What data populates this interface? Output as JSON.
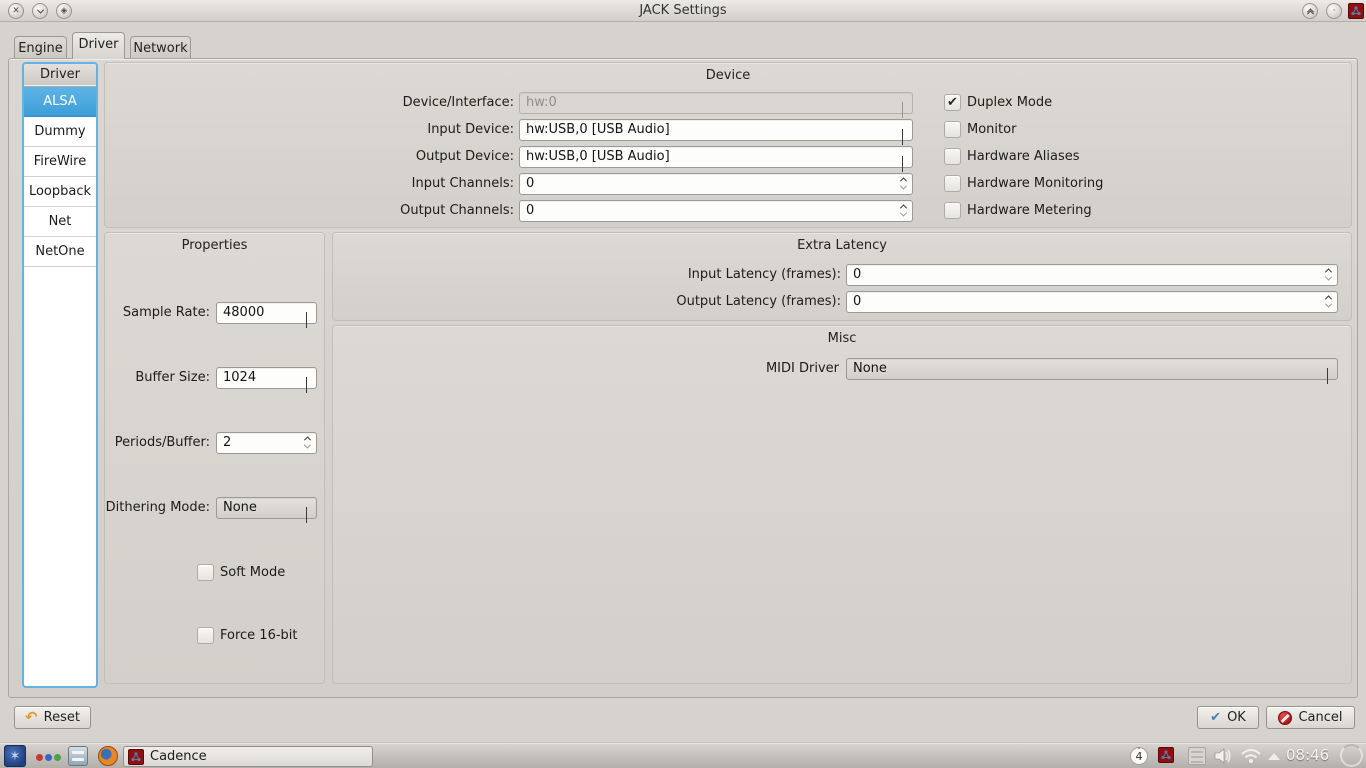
{
  "window": {
    "title": "JACK Settings",
    "buttons": {
      "close": "✕"
    }
  },
  "tabs": {
    "engine": "Engine",
    "driver": "Driver",
    "network": "Network",
    "active": "Driver"
  },
  "driver_list": {
    "header": "Driver",
    "items": [
      {
        "label": "ALSA",
        "selected": true
      },
      {
        "label": "Dummy",
        "selected": false
      },
      {
        "label": "FireWire",
        "selected": false
      },
      {
        "label": "Loopback",
        "selected": false
      },
      {
        "label": "Net",
        "selected": false
      },
      {
        "label": "NetOne",
        "selected": false
      }
    ]
  },
  "device": {
    "title": "Device",
    "interface_label": "Device/Interface:",
    "interface_value": "hw:0",
    "interface_enabled": false,
    "input_device_label": "Input Device:",
    "input_device_value": "hw:USB,0 [USB Audio]",
    "output_device_label": "Output Device:",
    "output_device_value": "hw:USB,0 [USB Audio]",
    "input_channels_label": "Input Channels:",
    "input_channels_value": "0",
    "output_channels_label": "Output Channels:",
    "output_channels_value": "0",
    "checkboxes": [
      {
        "label": "Duplex Mode",
        "checked": true,
        "glyph": "✔"
      },
      {
        "label": "Monitor",
        "checked": false,
        "glyph": ""
      },
      {
        "label": "Hardware Aliases",
        "checked": false,
        "glyph": ""
      },
      {
        "label": "Hardware Monitoring",
        "checked": false,
        "glyph": ""
      },
      {
        "label": "Hardware Metering",
        "checked": false,
        "glyph": ""
      }
    ]
  },
  "properties": {
    "title": "Properties",
    "sample_rate_label": "Sample Rate:",
    "sample_rate_value": "48000",
    "buffer_size_label": "Buffer Size:",
    "buffer_size_value": "1024",
    "periods_label": "Periods/Buffer:",
    "periods_value": "2",
    "dithering_label": "Dithering Mode:",
    "dithering_value": "None",
    "soft_mode": {
      "label": "Soft Mode",
      "checked": false,
      "glyph": ""
    },
    "force_16bit": {
      "label": "Force 16-bit",
      "checked": false,
      "glyph": ""
    }
  },
  "extra_latency": {
    "title": "Extra Latency",
    "input_label": "Input Latency (frames):",
    "input_value": "0",
    "output_label": "Output Latency (frames):",
    "output_value": "0"
  },
  "misc": {
    "title": "Misc",
    "midi_label": "MIDI Driver",
    "midi_value": "None"
  },
  "footer": {
    "reset": "Reset",
    "ok": "OK",
    "cancel": "Cancel"
  },
  "taskbar": {
    "task_label": "Cadence",
    "keyboard_badge": "4",
    "clock": "08:46",
    "icons": [
      "app-menu-icon",
      "pager-dots-icon",
      "file-manager-icon",
      "firefox-icon",
      "cadence-tray-icon",
      "notes-tray-icon",
      "volume-icon",
      "wifi-icon",
      "tray-expand-icon"
    ]
  },
  "colors": {
    "selection_blue": "#45a5dd",
    "table_border_blue": "#66b2e2",
    "dialog_bg": "#d6d2cd",
    "cadence_red": "#8f1010"
  }
}
